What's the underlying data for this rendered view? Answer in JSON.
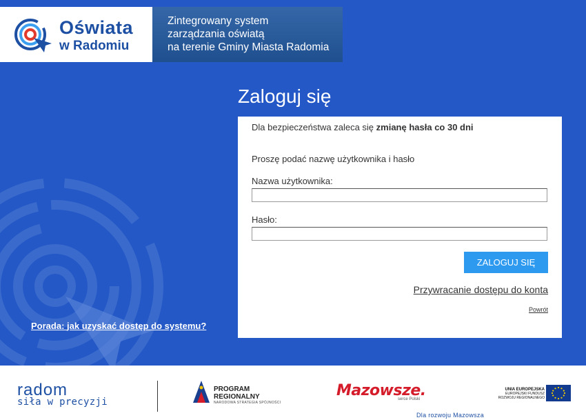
{
  "brand": {
    "name_line1": "Oświata",
    "name_line2": "w Radomiu",
    "tagline": [
      "Zintegrowany system",
      "zarządzania oświatą",
      "na terenie Gminy Miasta Radomia"
    ]
  },
  "login": {
    "title": "Zaloguj się",
    "notice_prefix": "Dla bezpieczeństwa zaleca się ",
    "notice_bold": "zmianę hasła co 30 dni",
    "prompt": "Proszę podać nazwę użytkownika i hasło",
    "username_label": "Nazwa użytkownika:",
    "username_value": "",
    "password_label": "Hasło:",
    "password_value": "",
    "submit_label": "ZALOGUJ SIĘ",
    "restore_link": "Przywracanie dostępu do konta",
    "back_link": "Powrót"
  },
  "hint": {
    "prefix": "Porada: ",
    "link": "jak uzyskać dostęp do systemu?"
  },
  "footer": {
    "radom_logo": "radom",
    "radom_slogan": "siła w precyzji",
    "program_line1": "PROGRAM",
    "program_line2": "REGIONALNY",
    "program_small": "NARODOWA STRATEGIA SPÓJNOŚCI",
    "mazowsze_logo": "Mazowsze.",
    "mazowsze_sub": "serce Polski",
    "mazowsze_foot": "Dla rozwoju Mazowsza",
    "ue_line1": "UNIA EUROPEJSKA",
    "ue_line2": "EUROPEJSKI FUNDUSZ",
    "ue_line3": "ROZWOJU REGIONALNEGO"
  },
  "colors": {
    "background": "#2458c6",
    "button": "#2d9af0",
    "brand_blue": "#1d4fa3",
    "mazowsze_red": "#d51c2a"
  }
}
